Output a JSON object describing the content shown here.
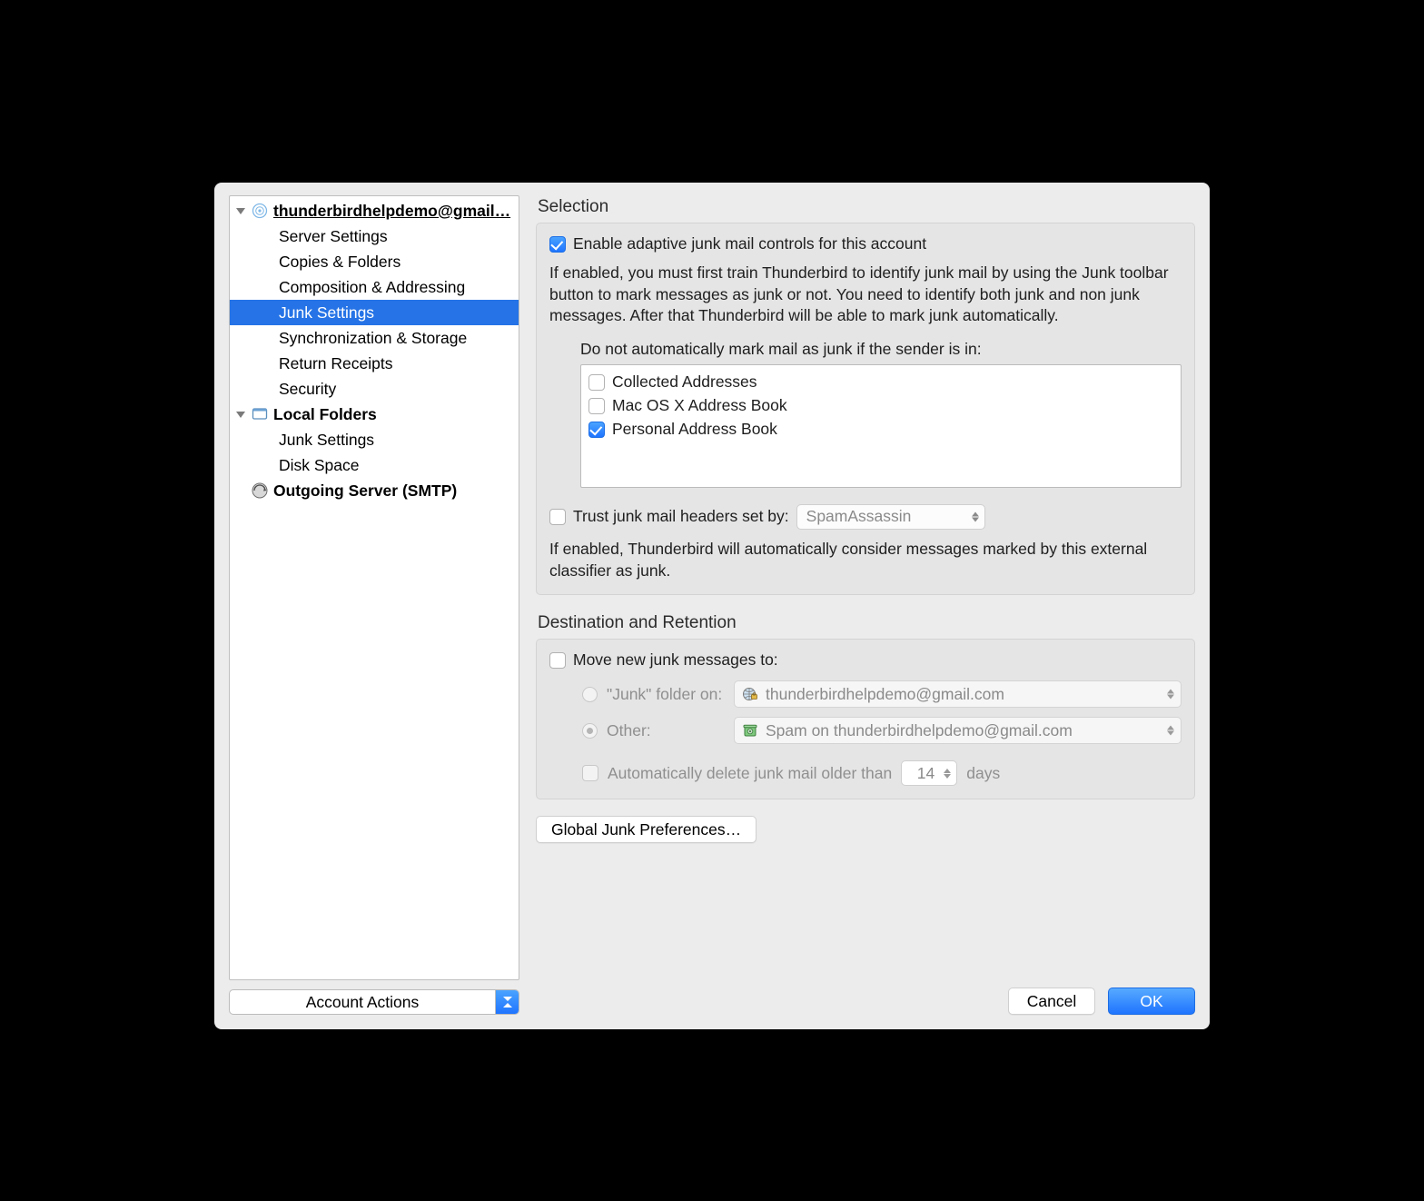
{
  "sidebar": {
    "account_label": "thunderbirdhelpdemo@gmail…",
    "account_items": [
      "Server Settings",
      "Copies & Folders",
      "Composition & Addressing",
      "Junk Settings",
      "Synchronization & Storage",
      "Return Receipts",
      "Security"
    ],
    "local_folders_label": "Local Folders",
    "local_items": [
      "Junk Settings",
      "Disk Space"
    ],
    "smtp_label": "Outgoing Server (SMTP)",
    "account_actions_label": "Account Actions"
  },
  "selection": {
    "title": "Selection",
    "enable_label": "Enable adaptive junk mail controls for this account",
    "help1": "If enabled, you must first train Thunderbird to identify junk mail by using the Junk toolbar button to mark messages as junk or not. You need to identify both junk and non junk messages. After that Thunderbird will be able to mark junk automatically.",
    "whitelist_label": "Do not automatically mark mail as junk if the sender is in:",
    "address_books": [
      {
        "label": "Collected Addresses",
        "checked": false
      },
      {
        "label": "Mac OS X Address Book",
        "checked": false
      },
      {
        "label": "Personal Address Book",
        "checked": true
      }
    ],
    "trust_label": "Trust junk mail headers set by:",
    "trust_select": "SpamAssassin",
    "help2": "If enabled, Thunderbird will automatically consider messages marked by this external classifier as junk."
  },
  "destination": {
    "title": "Destination and Retention",
    "move_label": "Move new junk messages to:",
    "junk_folder_label": "\"Junk\" folder on:",
    "junk_folder_value": "thunderbirdhelpdemo@gmail.com",
    "other_label": "Other:",
    "other_value": "Spam on thunderbirdhelpdemo@gmail.com",
    "auto_delete_label": "Automatically delete junk mail older than",
    "auto_delete_days": "14",
    "auto_delete_unit": "days"
  },
  "buttons": {
    "global_prefs": "Global Junk Preferences…",
    "cancel": "Cancel",
    "ok": "OK"
  }
}
